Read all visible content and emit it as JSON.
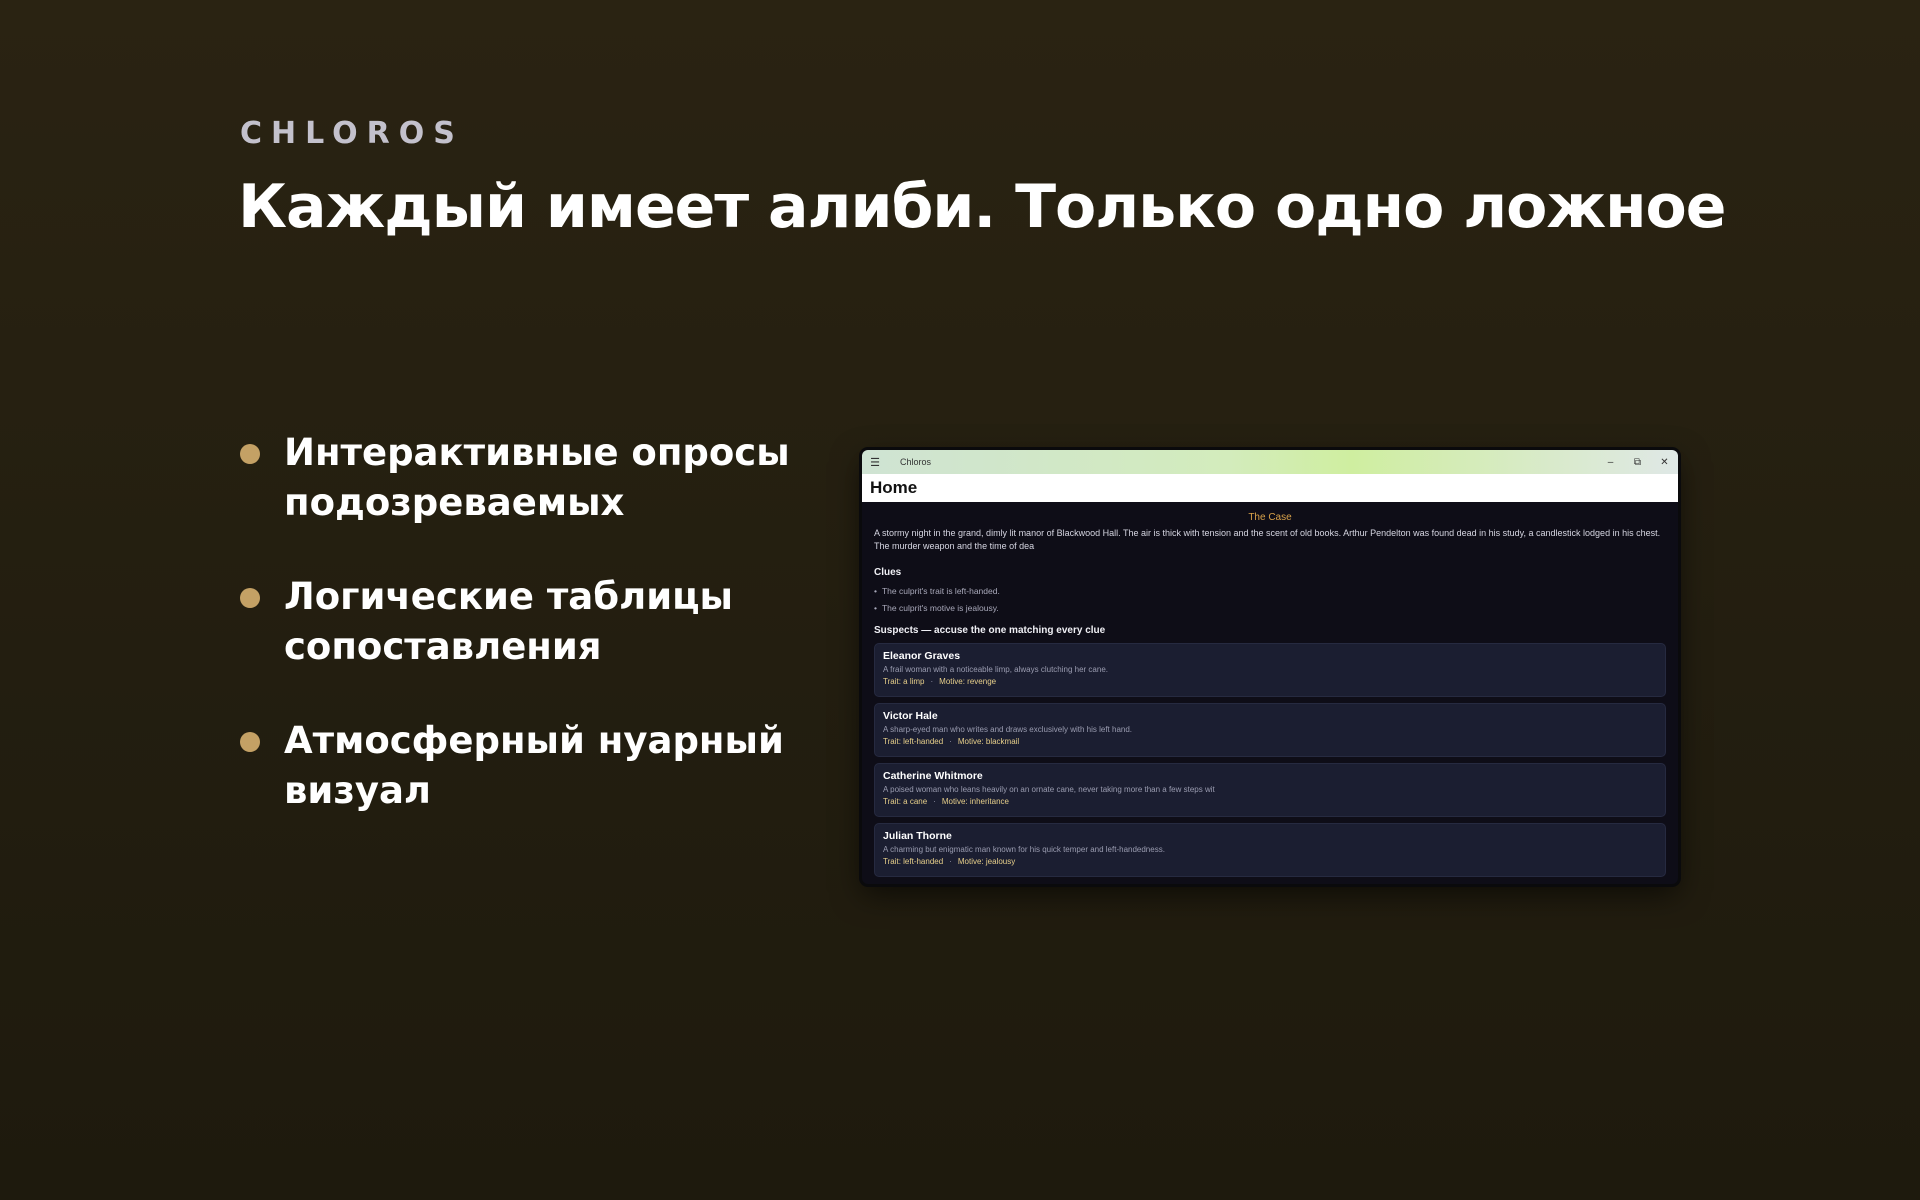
{
  "brand": "CHLOROS",
  "headline": "Каждый имеет алиби. Только одно ложное",
  "features": [
    "Интерактивные опросы подозреваемых",
    "Логические таблицы сопоставления",
    "Атмосферный нуарный визуал"
  ],
  "app": {
    "window_title": "Chloros",
    "page_title": "Home",
    "case_heading": "The Case",
    "case_body": "A stormy night in the grand, dimly lit manor of Blackwood Hall. The air is thick with tension and the scent of old books. Arthur Pendelton was found dead in his study, a candlestick lodged in his chest. The murder weapon and the time of dea",
    "clues_title": "Clues",
    "clues": [
      "The culprit's trait is left-handed.",
      "The culprit's motive is jealousy."
    ],
    "suspects_title": "Suspects — accuse the one matching every clue",
    "suspects": [
      {
        "name": "Eleanor Graves",
        "desc": "A frail woman with a noticeable limp, always clutching her cane.",
        "trait": "Trait: a limp",
        "motive": "Motive: revenge"
      },
      {
        "name": "Victor Hale",
        "desc": "A sharp-eyed man who writes and draws exclusively with his left hand.",
        "trait": "Trait: left-handed",
        "motive": "Motive: blackmail"
      },
      {
        "name": "Catherine Whitmore",
        "desc": "A poised woman who leans heavily on an ornate cane, never taking more than a few steps wit",
        "trait": "Trait: a cane",
        "motive": "Motive: inheritance"
      },
      {
        "name": "Julian Thorne",
        "desc": "A charming but enigmatic man known for his quick temper and left-handedness.",
        "trait": "Trait: left-handed",
        "motive": "Motive: jealousy"
      }
    ],
    "icons": {
      "menu": "hamburger-icon",
      "minimize": "minimize-icon",
      "restore": "restore-icon",
      "close": "close-icon"
    }
  },
  "colors": {
    "accent": "#c4a165",
    "case_heading": "#d9a24a",
    "card_bg": "#1b1e31",
    "meta_text": "#e7cf8a"
  }
}
